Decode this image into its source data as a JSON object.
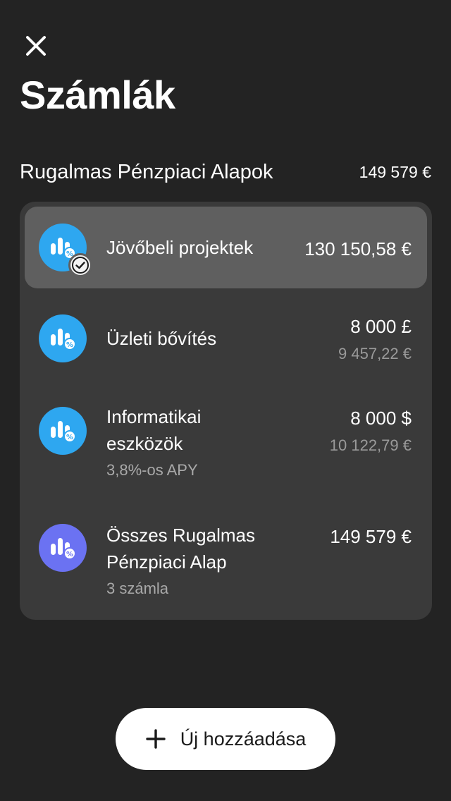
{
  "header": {
    "close_icon": "close-icon",
    "title": "Számlák"
  },
  "section": {
    "title": "Rugalmas Pénzpiaci Alapok",
    "total": "149 579 €"
  },
  "accounts": [
    {
      "title": "Jövőbeli projektek",
      "amount": "130 150,58 €",
      "selected": true,
      "icon": "money-market-fund-icon",
      "icon_color": "#2ea7f0"
    },
    {
      "title": "Üzleti bővítés",
      "amount": "8 000 £",
      "secondary_amount": "9 457,22 €",
      "icon": "money-market-fund-icon",
      "icon_color": "#2ea7f0"
    },
    {
      "title_line1": "Informatikai",
      "title_line2": "eszközök",
      "subtitle": "3,8%-os APY",
      "amount": "8 000 $",
      "secondary_amount": "10 122,79 €",
      "icon": "money-market-fund-icon",
      "icon_color": "#2ea7f0"
    },
    {
      "title_line1": "Összes Rugalmas",
      "title_line2": "Pénzpiaci Alap",
      "subtitle": "3 számla",
      "amount": "149 579 €",
      "icon": "money-market-fund-icon",
      "icon_color": "#6b72f2"
    }
  ],
  "add_button": {
    "label": "Új hozzáadása",
    "icon": "plus-icon"
  },
  "colors": {
    "background": "#232323",
    "card": "#3a3a3a",
    "selected_row": "#5f5f5f",
    "accent_blue": "#2ea7f0",
    "accent_violet": "#6b72f2"
  }
}
